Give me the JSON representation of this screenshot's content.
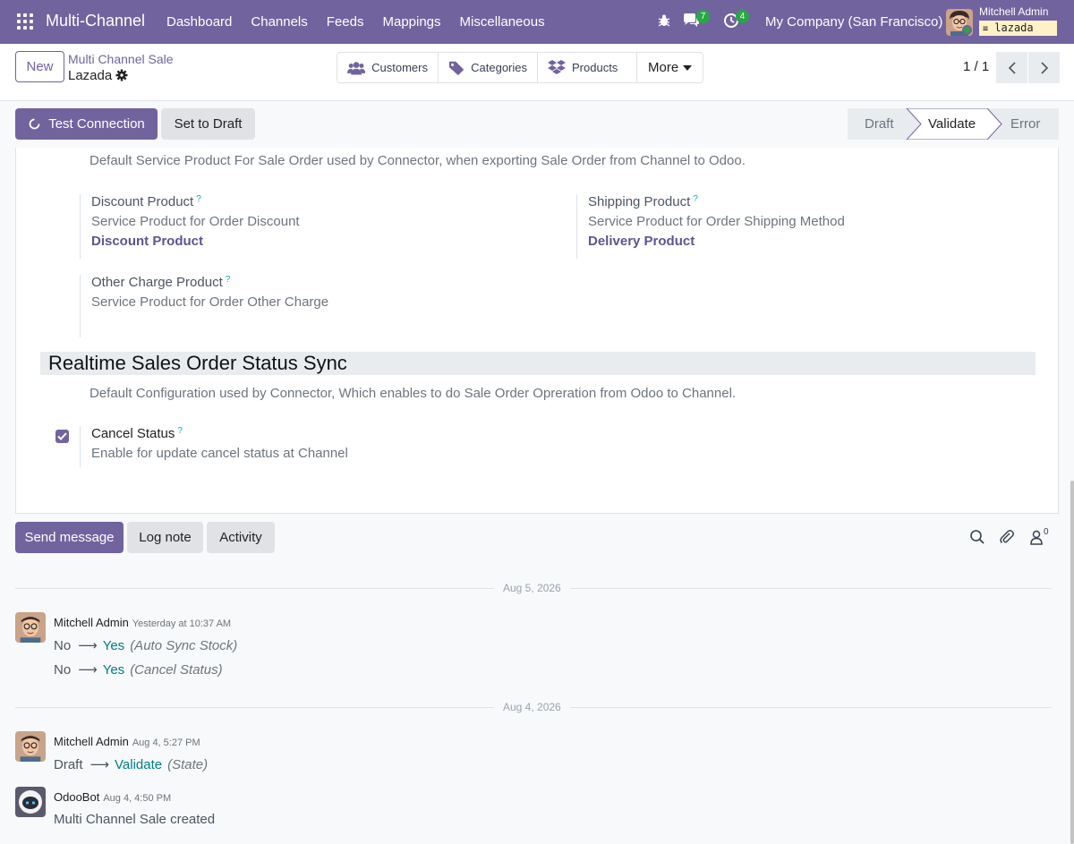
{
  "navbar": {
    "brand": "Multi-Channel",
    "menu": [
      "Dashboard",
      "Channels",
      "Feeds",
      "Mappings",
      "Miscellaneous"
    ],
    "chat_badge": "7",
    "activity_badge": "4",
    "company": "My Company (San Francisco)",
    "user_name": "Mitchell Admin",
    "db_name": "lazada"
  },
  "control": {
    "new_label": "New",
    "breadcrumb_parent": "Multi Channel Sale",
    "breadcrumb_current": "Lazada",
    "smart_buttons": [
      "Customers",
      "Categories",
      "Products"
    ],
    "more_label": "More",
    "pager": "1 / 1"
  },
  "statusbar": {
    "test_connection": "Test Connection",
    "set_to_draft": "Set to Draft",
    "stages": [
      "Draft",
      "Validate",
      "Error"
    ],
    "active_stage": "Validate"
  },
  "form": {
    "top_help": "Default Service Product For Sale Order used by Connector, when exporting Sale Order from Channel to Odoo.",
    "discount": {
      "label": "Discount Product",
      "help": "Service Product for Order Discount",
      "value": "Discount Product"
    },
    "shipping": {
      "label": "Shipping Product",
      "help": "Service Product for Order Shipping Method",
      "value": "Delivery Product"
    },
    "other": {
      "label": "Other Charge Product",
      "help": "Service Product for Order Other Charge"
    },
    "section_title": "Realtime Sales Order Status Sync",
    "section_help": "Default Configuration used by Connector, Which enables to do Sale Order Opreration from Odoo to Channel.",
    "cancel_status": {
      "label": "Cancel Status",
      "help": "Enable for update cancel status at Channel",
      "checked": true
    },
    "tooltip_mark": "?"
  },
  "chatter": {
    "send_message": "Send message",
    "log_note": "Log note",
    "activity": "Activity",
    "followers_count": "0",
    "date1": "Aug 5, 2026",
    "date2": "Aug 4, 2026",
    "messages": [
      {
        "author": "Mitchell Admin",
        "date": "Yesterday at 10:37 AM",
        "lines": [
          {
            "old": "No",
            "new": "Yes",
            "field": "(Auto Sync Stock)"
          },
          {
            "old": "No",
            "new": "Yes",
            "field": "(Cancel Status)"
          }
        ]
      },
      {
        "author": "Mitchell Admin",
        "date": "Aug 4, 5:27 PM",
        "lines": [
          {
            "old": "Draft",
            "new": "Validate",
            "field": "(State)"
          }
        ]
      },
      {
        "author": "OdooBot",
        "date": "Aug 4, 4:50 PM",
        "body": "Multi Channel Sale created"
      }
    ]
  }
}
